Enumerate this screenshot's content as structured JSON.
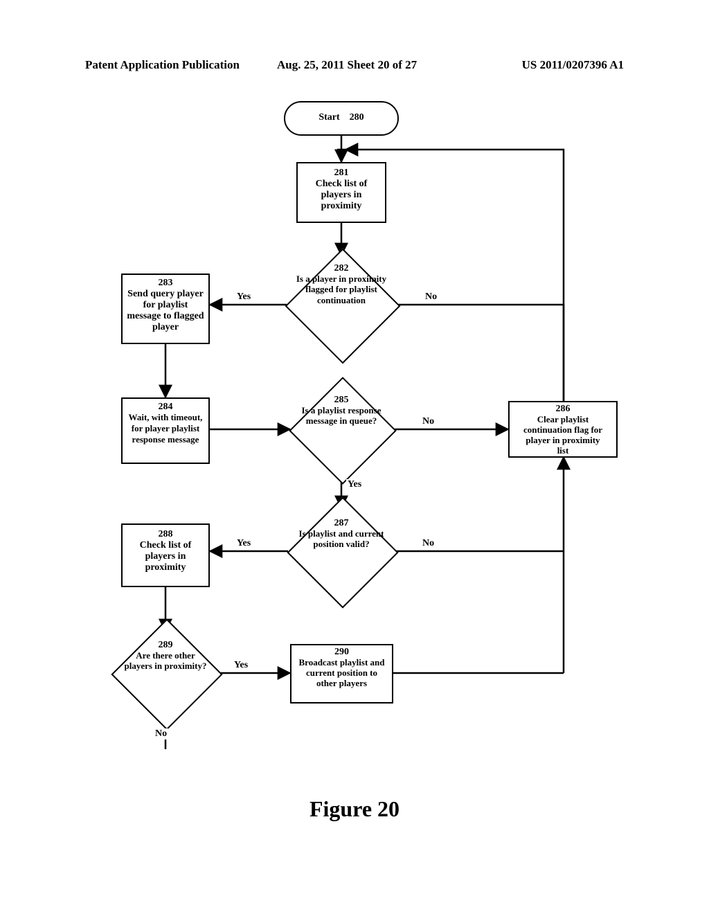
{
  "header": {
    "left": "Patent Application Publication",
    "center": "Aug. 25, 2011  Sheet 20 of 27",
    "right": "US 2011/0207396 A1"
  },
  "figure_title": "Figure 20",
  "nodes": {
    "n280": {
      "num": "280",
      "text": "Start"
    },
    "n281": {
      "num": "281",
      "text": "Check list of players in proximity"
    },
    "n282": {
      "num": "282",
      "text": "Is a player in proximity flagged for playlist continuation"
    },
    "n283": {
      "num": "283",
      "text": "Send query player for playlist message to flagged player"
    },
    "n284": {
      "num": "284",
      "text": "Wait, with timeout, for player playlist response message"
    },
    "n285": {
      "num": "285",
      "text": "Is a playlist response message in queue?"
    },
    "n286": {
      "num": "286",
      "text": "Clear playlist continuation flag for player in proximity list"
    },
    "n287": {
      "num": "287",
      "text": "Is playlist and current position valid?"
    },
    "n288": {
      "num": "288",
      "text": "Check list of players in proximity"
    },
    "n289": {
      "num": "289",
      "text": "Are there other players in proximity?"
    },
    "n290": {
      "num": "290",
      "text": "Broadcast playlist and current position to other players"
    }
  },
  "labels": {
    "yes": "Yes",
    "no": "No"
  },
  "chart_data": {
    "type": "flowchart",
    "nodes": [
      {
        "id": "280",
        "shape": "terminator",
        "text": "Start"
      },
      {
        "id": "281",
        "shape": "process",
        "text": "Check list of players in proximity"
      },
      {
        "id": "282",
        "shape": "decision",
        "text": "Is a player in proximity flagged for playlist continuation"
      },
      {
        "id": "283",
        "shape": "process",
        "text": "Send query player for playlist message to flagged player"
      },
      {
        "id": "284",
        "shape": "process",
        "text": "Wait, with timeout, for player playlist response message"
      },
      {
        "id": "285",
        "shape": "decision",
        "text": "Is a playlist response message in queue?"
      },
      {
        "id": "286",
        "shape": "process",
        "text": "Clear playlist continuation flag for player in proximity list"
      },
      {
        "id": "287",
        "shape": "decision",
        "text": "Is playlist and current position valid?"
      },
      {
        "id": "288",
        "shape": "process",
        "text": "Check list of players in proximity"
      },
      {
        "id": "289",
        "shape": "decision",
        "text": "Are there other players in proximity?"
      },
      {
        "id": "290",
        "shape": "process",
        "text": "Broadcast playlist and current position to other players"
      }
    ],
    "edges": [
      {
        "from": "280",
        "to": "281"
      },
      {
        "from": "281",
        "to": "282"
      },
      {
        "from": "282",
        "to": "283",
        "label": "Yes"
      },
      {
        "from": "282",
        "to": "286",
        "label": "No",
        "note": "joins 286→281 return path"
      },
      {
        "from": "283",
        "to": "284"
      },
      {
        "from": "284",
        "to": "285"
      },
      {
        "from": "285",
        "to": "286",
        "label": "No"
      },
      {
        "from": "285",
        "to": "287",
        "label": "Yes"
      },
      {
        "from": "287",
        "to": "288",
        "label": "Yes"
      },
      {
        "from": "287",
        "to": "286",
        "label": "No",
        "note": "joins 286→281 return path"
      },
      {
        "from": "288",
        "to": "289"
      },
      {
        "from": "289",
        "to": "290",
        "label": "Yes"
      },
      {
        "from": "290",
        "to": "286",
        "note": "joins 286→281 return path"
      },
      {
        "from": "289",
        "to": "281",
        "label": "No",
        "note": "loops back to start of cycle"
      },
      {
        "from": "286",
        "to": "281",
        "note": "return path up right side"
      }
    ]
  }
}
